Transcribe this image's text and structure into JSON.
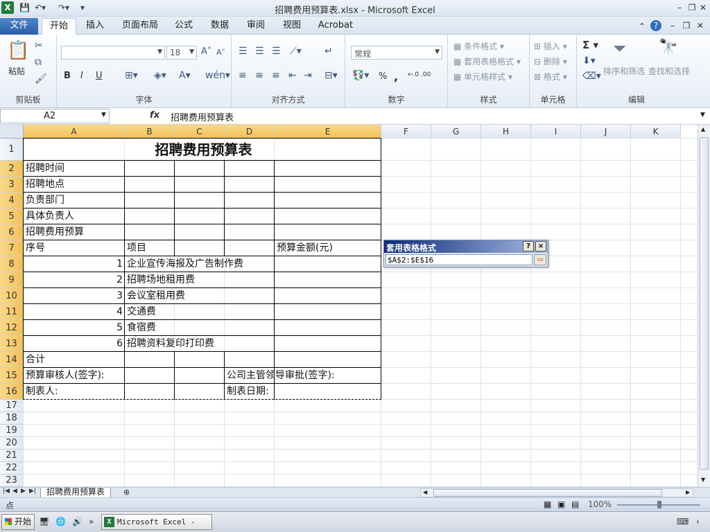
{
  "window": {
    "title": "招聘费用预算表.xlsx  -  Microsoft Excel",
    "app_icon": "excel-icon"
  },
  "ribbon_tabs": [
    "文件",
    "开始",
    "插入",
    "页面布局",
    "公式",
    "数据",
    "审阅",
    "视图",
    "Acrobat"
  ],
  "active_tab": "开始",
  "ribbon": {
    "clipboard": {
      "label": "剪贴板",
      "paste": "粘贴"
    },
    "font": {
      "label": "字体",
      "font_name": "",
      "font_size": "18",
      "bold": "B",
      "italic": "I",
      "underline": "U"
    },
    "alignment": {
      "label": "对齐方式"
    },
    "number": {
      "label": "数字",
      "format": "常规",
      "percent": "%",
      "comma": ",",
      "inc_dec": "←.0 .00",
      "dec_dec": ".00 →.0"
    },
    "styles": {
      "label": "样式",
      "conditional": "条件格式",
      "table_format": "套用表格格式",
      "cell_styles": "单元格样式"
    },
    "cells": {
      "label": "单元格",
      "insert": "插入",
      "delete": "删除",
      "format": "格式"
    },
    "editing": {
      "label": "编辑",
      "sort": "排序和筛选",
      "find": "查找和选择",
      "sigma": "Σ"
    }
  },
  "formula_bar": {
    "name_box": "A2",
    "fx": "fx",
    "content": "招聘费用预算表"
  },
  "columns": [
    "A",
    "B",
    "C",
    "D",
    "E",
    "F",
    "G",
    "H",
    "I",
    "J",
    "K"
  ],
  "rows": [
    "1",
    "2",
    "3",
    "4",
    "5",
    "6",
    "7",
    "8",
    "9",
    "10",
    "11",
    "12",
    "13",
    "14",
    "15",
    "16",
    "17",
    "18",
    "19",
    "20",
    "21",
    "22",
    "23"
  ],
  "cells": {
    "title": "招聘费用预算表",
    "a2": "招聘时间",
    "a3": "招聘地点",
    "a4": "负责部门",
    "a5": "具体负责人",
    "a6": "招聘费用预算",
    "a7": "序号",
    "b7": "项目",
    "e7": "预算金额(元)",
    "items": [
      {
        "no": "1",
        "name": "企业宣传海报及广告制作费"
      },
      {
        "no": "2",
        "name": "招聘场地租用费"
      },
      {
        "no": "3",
        "name": "会议室租用费"
      },
      {
        "no": "4",
        "name": "交通费"
      },
      {
        "no": "5",
        "name": "食宿费"
      },
      {
        "no": "6",
        "name": "招聘资料复印打印费"
      }
    ],
    "a14": "合计",
    "a15": "预算审核人(签字):",
    "d15": "公司主管领导审批(签字):",
    "a16": "制表人:",
    "d16": "制表日期:"
  },
  "dialog": {
    "title": "套用表格格式",
    "help": "?",
    "close": "×",
    "range": "$A$2:$E$16"
  },
  "sheet_tab": "招聘费用预算表",
  "status": {
    "mode": "点",
    "zoom": "100%"
  },
  "taskbar": {
    "start": "开始",
    "app": "Microsoft Excel - ..."
  }
}
